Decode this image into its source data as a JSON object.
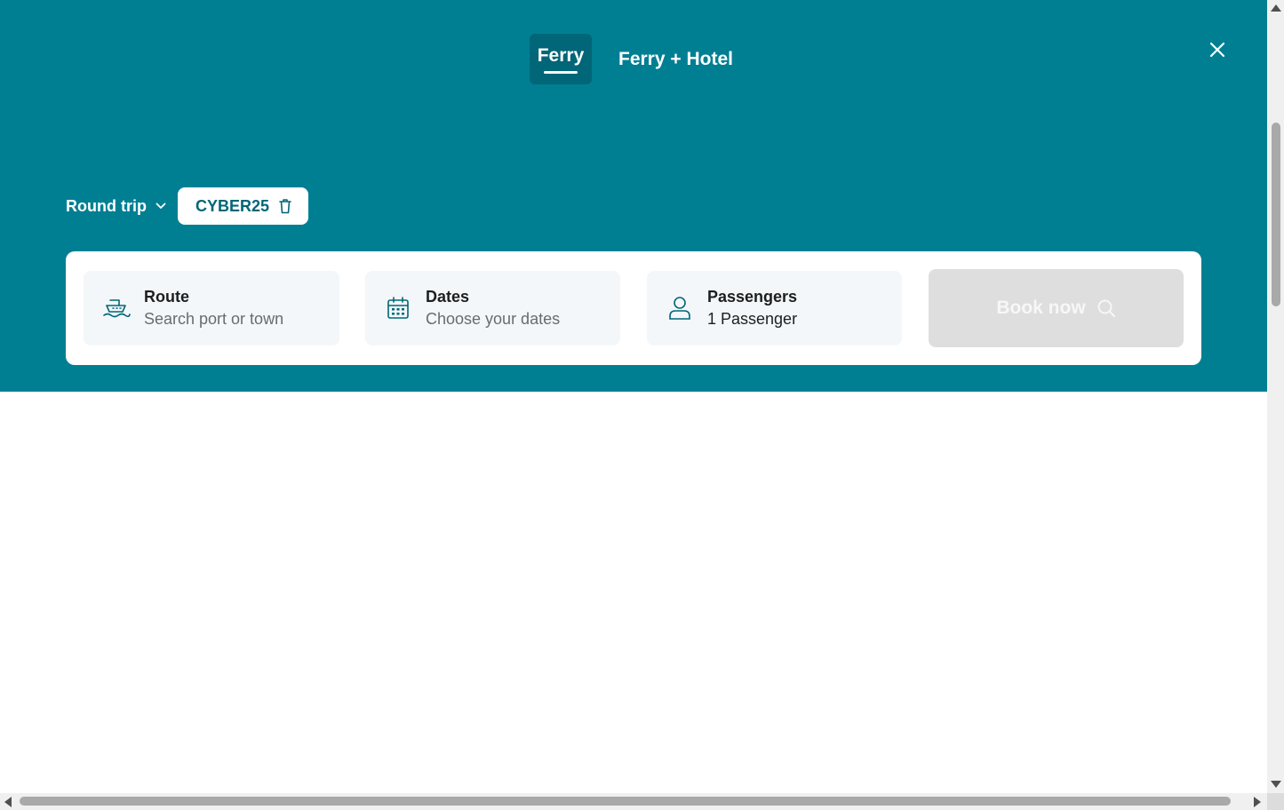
{
  "tabs": {
    "ferry": "Ferry",
    "ferry_hotel": "Ferry + Hotel"
  },
  "trip": {
    "type_label": "Round trip"
  },
  "promo": {
    "code": "CYBER25"
  },
  "search": {
    "route": {
      "label": "Route",
      "placeholder": "Search port or town",
      "icon": "ship-icon"
    },
    "dates": {
      "label": "Dates",
      "placeholder": "Choose your dates",
      "icon": "calendar-icon"
    },
    "passengers": {
      "label": "Passengers",
      "value": "1 Passenger",
      "icon": "person-icon"
    },
    "book_label": "Book now"
  },
  "colors": {
    "brand": "#007f93",
    "brand_dark": "#016677",
    "field_bg": "#f3f7fa",
    "button_disabled": "#dedede"
  }
}
